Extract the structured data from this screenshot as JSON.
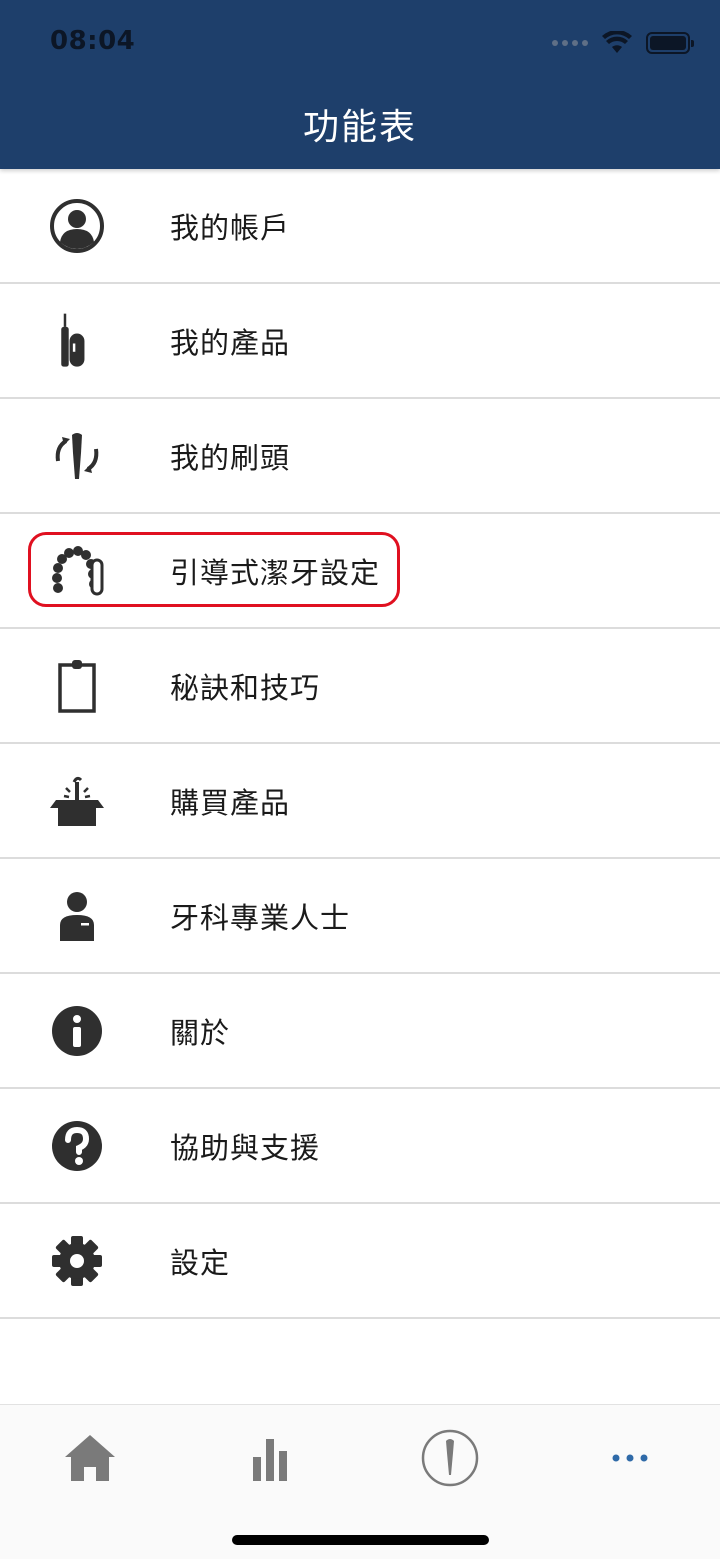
{
  "status_bar": {
    "time": "08:04"
  },
  "header": {
    "title": "功能表"
  },
  "menu": [
    {
      "label": "我的帳戶",
      "icon": "account-icon"
    },
    {
      "label": "我的產品",
      "icon": "toothbrush-product-icon"
    },
    {
      "label": "我的刷頭",
      "icon": "brush-head-replace-icon"
    },
    {
      "label": "引導式潔牙設定",
      "icon": "teeth-arch-icon",
      "highlighted": true
    },
    {
      "label": "秘訣和技巧",
      "icon": "clipboard-icon"
    },
    {
      "label": "購買產品",
      "icon": "open-box-icon"
    },
    {
      "label": "牙科專業人士",
      "icon": "professional-person-icon"
    },
    {
      "label": "關於",
      "icon": "info-icon"
    },
    {
      "label": "協助與支援",
      "icon": "help-icon"
    },
    {
      "label": "設定",
      "icon": "gear-icon"
    }
  ],
  "tabbar": {
    "tabs": [
      {
        "icon": "home-icon"
      },
      {
        "icon": "stats-icon"
      },
      {
        "icon": "brush-icon"
      },
      {
        "icon": "more-icon"
      }
    ]
  },
  "colors": {
    "header_bg": "#1e3f6b",
    "icon": "#2f2f2f",
    "highlight": "#e01020",
    "tab_active": "#2f6aa8",
    "tab_inactive": "#7a7a7a"
  }
}
